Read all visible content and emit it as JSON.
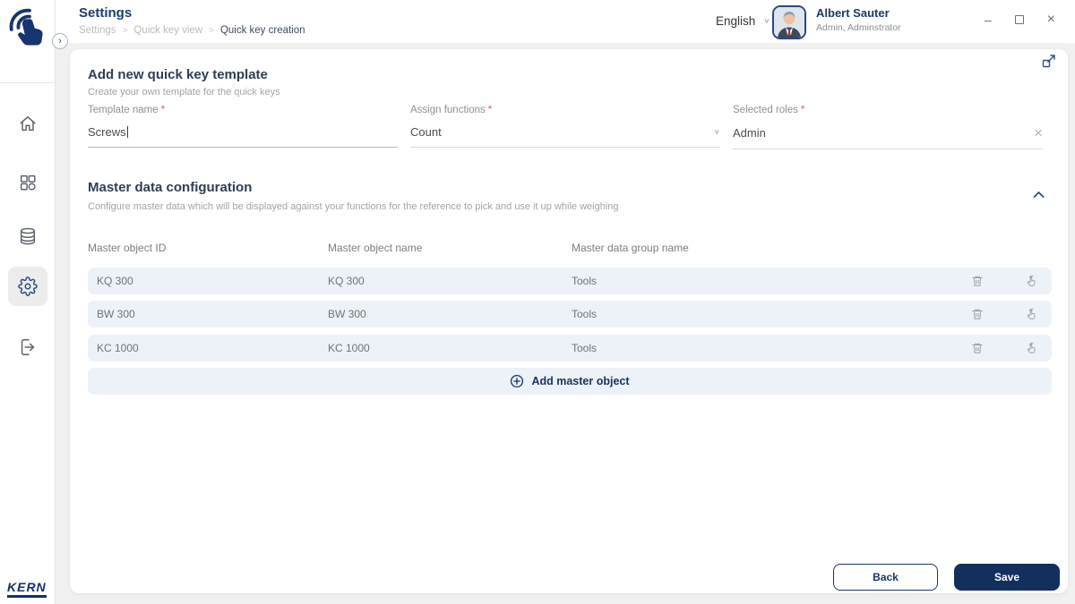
{
  "header": {
    "title": "Settings",
    "breadcrumb": {
      "items": [
        "Settings",
        "Quick key view",
        "Quick key creation"
      ],
      "separator": ">"
    },
    "language": {
      "label": "English",
      "chevron": "∨"
    },
    "user": {
      "name": "Albert Sauter",
      "role": "Admin, Adminstrator"
    },
    "window_controls": {
      "minimize": "–",
      "close": "×"
    }
  },
  "sidebar": {
    "brand": "KERN",
    "expand_chevron": "›"
  },
  "card": {
    "form": {
      "title": "Add new quick key template",
      "subtitle": "Create your own template for the quick keys",
      "required_mark": "*",
      "fields": {
        "template_name": {
          "label": "Template name",
          "value": "Screws"
        },
        "assign_functions": {
          "label": "Assign functions",
          "value": "Count",
          "chevron": "∨"
        },
        "selected_roles": {
          "label": "Selected roles",
          "value": "Admin",
          "clear": "×"
        }
      }
    },
    "master": {
      "title": "Master data configuration",
      "subtitle": "Configure master data which will be displayed against your functions for the reference to pick and use it up while weighing",
      "columns": [
        "Master object ID",
        "Master object name",
        "Master data group name"
      ],
      "rows": [
        {
          "id": "KQ 300",
          "name": "KQ 300",
          "group": "Tools"
        },
        {
          "id": "BW 300",
          "name": "BW 300",
          "group": "Tools"
        },
        {
          "id": "KC 1000",
          "name": "KC 1000",
          "group": "Tools"
        }
      ],
      "add_button": {
        "label": "Add master object"
      }
    },
    "footer": {
      "back": "Back",
      "save": "Save"
    }
  },
  "colors": {
    "navy": "#16335f",
    "row_bg": "#edf1f8",
    "required": "#e05c5c"
  },
  "icons": {
    "logo": "touch-hand",
    "nav": [
      "home",
      "apps-grid",
      "database",
      "gear",
      "logout"
    ],
    "row": [
      "trash",
      "touch-hand"
    ],
    "misc": [
      "fullscreen-expand",
      "circle-plus",
      "collapse-chevron"
    ]
  }
}
